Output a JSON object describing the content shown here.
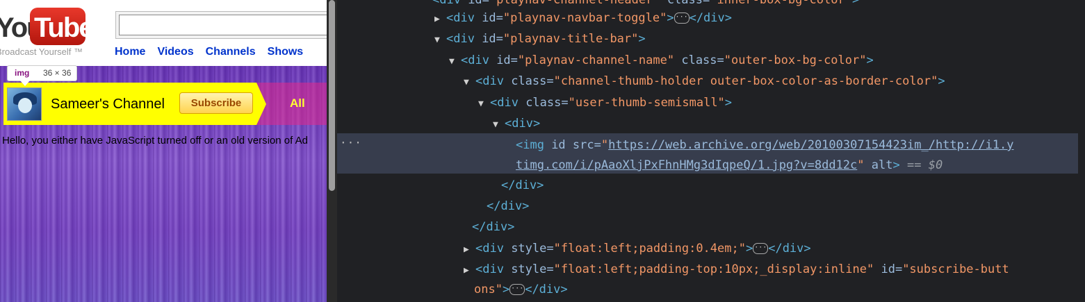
{
  "page": {
    "logo": {
      "you": "You",
      "tube": "Tube"
    },
    "slogan": "Broadcast Yourself ™",
    "search_value": "",
    "nav": [
      "Home",
      "Videos",
      "Channels",
      "Shows"
    ],
    "tooltip": {
      "tag": "img",
      "size": "36 × 36"
    },
    "channel_title": "Sameer's Channel",
    "subscribe_label": "Subscribe",
    "all_tab": "All",
    "nojs_message": "Hello, you either have JavaScript turned off or an old version of Ad"
  },
  "devtools": {
    "top_partial": {
      "tag_open": "<div ",
      "attr1": "id",
      "val1": "\"playnav-channel-header\"",
      "attr2": "class",
      "val2": "\"inner-box-bg-color\"",
      "tag_close": ">"
    },
    "lines": [
      {
        "tag_open": "<div ",
        "attr": "id",
        "eq": "=",
        "val": "\"playnav-navbar-toggle\"",
        "tag_close": ">",
        "ellipsis": "···",
        "end_tag": "</div>"
      },
      {
        "tag_open": "<div ",
        "attr": "id",
        "eq": "=",
        "val": "\"playnav-title-bar\"",
        "tag_close": ">"
      },
      {
        "tag_open": "<div ",
        "attr": "id",
        "eq": "=",
        "val": "\"playnav-channel-name\"",
        "attr2": "class",
        "val2": "\"outer-box-bg-color\"",
        "tag_close": ">"
      },
      {
        "tag_open": "<div ",
        "attr": "class",
        "eq": "=",
        "val": "\"channel-thumb-holder outer-box-color-as-border-color\"",
        "tag_close": ">"
      },
      {
        "tag_open": "<div ",
        "attr": "class",
        "eq": "=",
        "val": "\"user-thumb-semismall\"",
        "tag_close": ">"
      },
      {
        "tag_open": "<div>"
      }
    ],
    "selected": {
      "dots": "···",
      "tag_open": "<img ",
      "attr_id": "id",
      "attr_src": "src",
      "eq": "=",
      "url_line1": "https://web.archive.org/web/20100307154423im_/http://i1.y",
      "url_line2": "timg.com/i/pAaoXljPxFhnHMg3dIqpeQ/1.jpg?v=8dd12c",
      "quote": "\"",
      "attr_alt": "alt",
      "tag_close": ">",
      "eq_marker": "==",
      "dollar": "$0"
    },
    "closers": [
      "</div>",
      "</div>",
      "</div>"
    ],
    "after": [
      {
        "tag_open": "<div ",
        "attr": "style",
        "eq": "=",
        "val": "\"float:left;padding:0.4em;\"",
        "tag_close": ">",
        "ellipsis": "···",
        "end_tag": "</div>"
      },
      {
        "tag_open": "<div ",
        "attr": "style",
        "eq": "=",
        "val": "\"float:left;padding-top:10px;_display:inline\"",
        "attr2": "id",
        "val2_line1": "\"subscribe-butt",
        "val2_line2": "ons\"",
        "tag_close": ">",
        "ellipsis": "···",
        "end_tag": "</div>"
      }
    ],
    "colors": {
      "tag": "#5db0d7",
      "attr": "#9bbbdc",
      "value": "#f29766",
      "selected_bg": "#373d4d",
      "bg": "#202124"
    }
  }
}
